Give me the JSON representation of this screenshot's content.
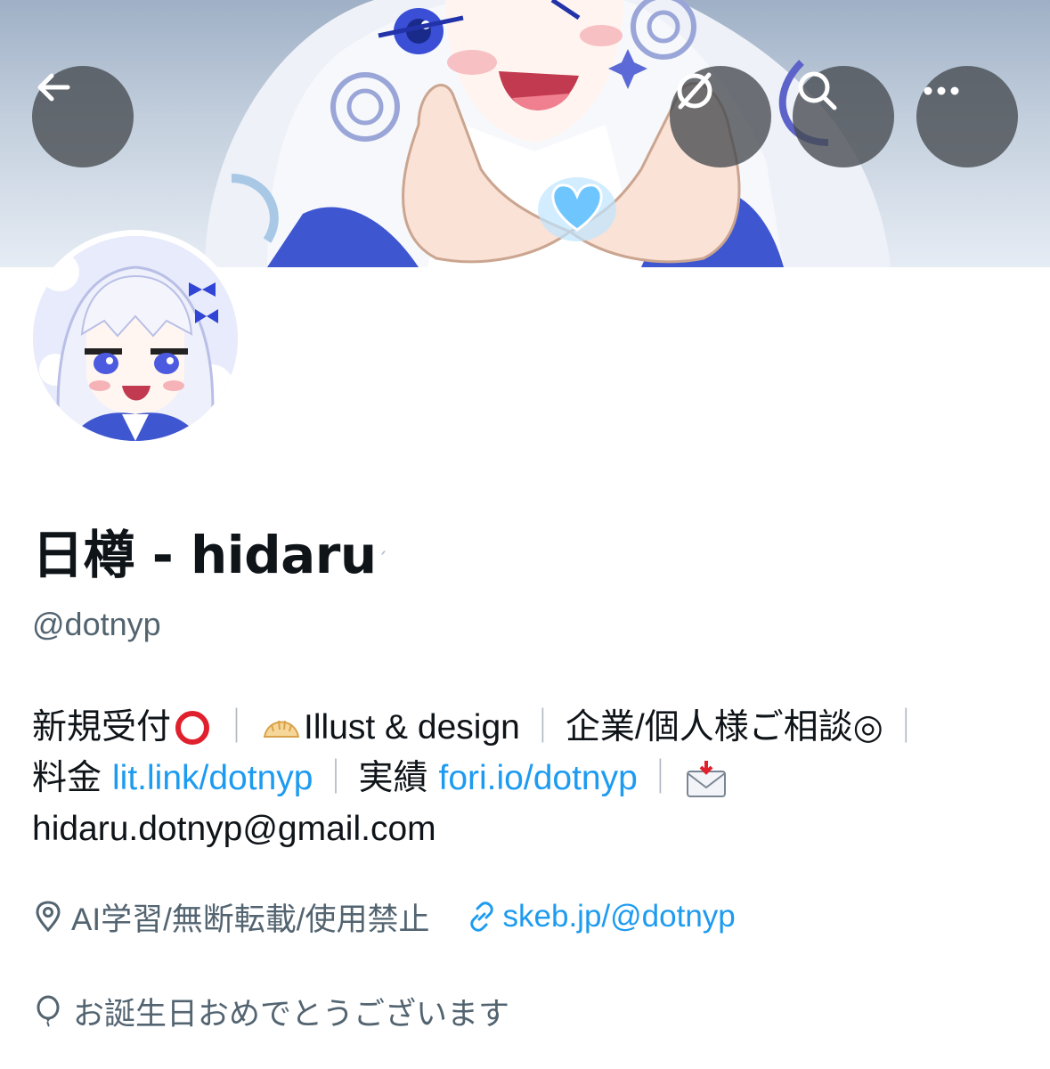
{
  "header": {
    "back_icon": "arrow-left-icon",
    "sync_icon": "circle-slash-icon",
    "search_icon": "search-icon",
    "more_icon": "more-horizontal-icon"
  },
  "profile": {
    "display_name": "日樽 - hidaru",
    "handle": "@dotnyp",
    "bio": {
      "line1": {
        "part1": "新規受付",
        "part2": "Illust & design",
        "part3": "企業/個人様ご相談◎"
      },
      "line2": {
        "label1": "料金",
        "link1": "lit.link/dotnyp",
        "label2": "実績",
        "link2": "fori.io/dotnyp"
      },
      "line3": "hidaru.dotnyp@gmail.com"
    },
    "location": "AI学習/無断転載/使用禁止",
    "website": "skeb.jp/@dotnyp",
    "birthday_text": "お誕生日おめでとうございます"
  },
  "colors": {
    "accent": "#1d9bf0",
    "secondary_text": "#536471",
    "primary_text": "#0f1419"
  }
}
